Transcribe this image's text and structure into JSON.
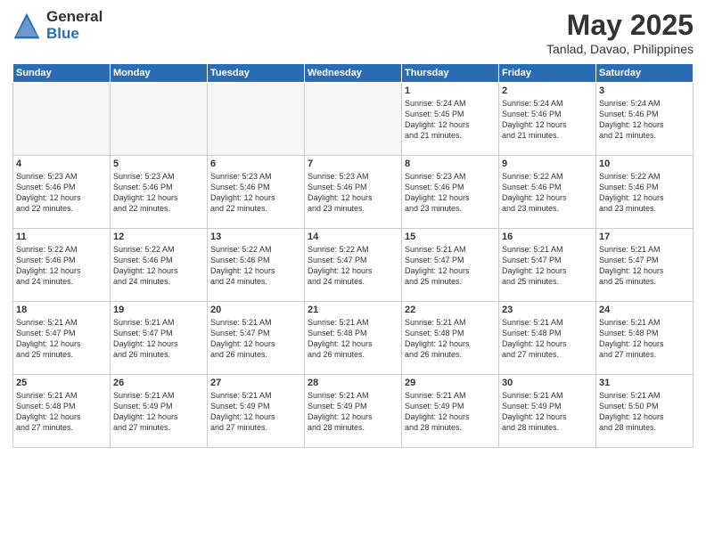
{
  "logo": {
    "general": "General",
    "blue": "Blue"
  },
  "title": {
    "month": "May 2025",
    "location": "Tanlad, Davao, Philippines"
  },
  "weekdays": [
    "Sunday",
    "Monday",
    "Tuesday",
    "Wednesday",
    "Thursday",
    "Friday",
    "Saturday"
  ],
  "weeks": [
    [
      {
        "day": "",
        "info": ""
      },
      {
        "day": "",
        "info": ""
      },
      {
        "day": "",
        "info": ""
      },
      {
        "day": "",
        "info": ""
      },
      {
        "day": "1",
        "info": "Sunrise: 5:24 AM\nSunset: 5:45 PM\nDaylight: 12 hours\nand 21 minutes."
      },
      {
        "day": "2",
        "info": "Sunrise: 5:24 AM\nSunset: 5:46 PM\nDaylight: 12 hours\nand 21 minutes."
      },
      {
        "day": "3",
        "info": "Sunrise: 5:24 AM\nSunset: 5:46 PM\nDaylight: 12 hours\nand 21 minutes."
      }
    ],
    [
      {
        "day": "4",
        "info": "Sunrise: 5:23 AM\nSunset: 5:46 PM\nDaylight: 12 hours\nand 22 minutes."
      },
      {
        "day": "5",
        "info": "Sunrise: 5:23 AM\nSunset: 5:46 PM\nDaylight: 12 hours\nand 22 minutes."
      },
      {
        "day": "6",
        "info": "Sunrise: 5:23 AM\nSunset: 5:46 PM\nDaylight: 12 hours\nand 22 minutes."
      },
      {
        "day": "7",
        "info": "Sunrise: 5:23 AM\nSunset: 5:46 PM\nDaylight: 12 hours\nand 23 minutes."
      },
      {
        "day": "8",
        "info": "Sunrise: 5:23 AM\nSunset: 5:46 PM\nDaylight: 12 hours\nand 23 minutes."
      },
      {
        "day": "9",
        "info": "Sunrise: 5:22 AM\nSunset: 5:46 PM\nDaylight: 12 hours\nand 23 minutes."
      },
      {
        "day": "10",
        "info": "Sunrise: 5:22 AM\nSunset: 5:46 PM\nDaylight: 12 hours\nand 23 minutes."
      }
    ],
    [
      {
        "day": "11",
        "info": "Sunrise: 5:22 AM\nSunset: 5:46 PM\nDaylight: 12 hours\nand 24 minutes."
      },
      {
        "day": "12",
        "info": "Sunrise: 5:22 AM\nSunset: 5:46 PM\nDaylight: 12 hours\nand 24 minutes."
      },
      {
        "day": "13",
        "info": "Sunrise: 5:22 AM\nSunset: 5:46 PM\nDaylight: 12 hours\nand 24 minutes."
      },
      {
        "day": "14",
        "info": "Sunrise: 5:22 AM\nSunset: 5:47 PM\nDaylight: 12 hours\nand 24 minutes."
      },
      {
        "day": "15",
        "info": "Sunrise: 5:21 AM\nSunset: 5:47 PM\nDaylight: 12 hours\nand 25 minutes."
      },
      {
        "day": "16",
        "info": "Sunrise: 5:21 AM\nSunset: 5:47 PM\nDaylight: 12 hours\nand 25 minutes."
      },
      {
        "day": "17",
        "info": "Sunrise: 5:21 AM\nSunset: 5:47 PM\nDaylight: 12 hours\nand 25 minutes."
      }
    ],
    [
      {
        "day": "18",
        "info": "Sunrise: 5:21 AM\nSunset: 5:47 PM\nDaylight: 12 hours\nand 25 minutes."
      },
      {
        "day": "19",
        "info": "Sunrise: 5:21 AM\nSunset: 5:47 PM\nDaylight: 12 hours\nand 26 minutes."
      },
      {
        "day": "20",
        "info": "Sunrise: 5:21 AM\nSunset: 5:47 PM\nDaylight: 12 hours\nand 26 minutes."
      },
      {
        "day": "21",
        "info": "Sunrise: 5:21 AM\nSunset: 5:48 PM\nDaylight: 12 hours\nand 26 minutes."
      },
      {
        "day": "22",
        "info": "Sunrise: 5:21 AM\nSunset: 5:48 PM\nDaylight: 12 hours\nand 26 minutes."
      },
      {
        "day": "23",
        "info": "Sunrise: 5:21 AM\nSunset: 5:48 PM\nDaylight: 12 hours\nand 27 minutes."
      },
      {
        "day": "24",
        "info": "Sunrise: 5:21 AM\nSunset: 5:48 PM\nDaylight: 12 hours\nand 27 minutes."
      }
    ],
    [
      {
        "day": "25",
        "info": "Sunrise: 5:21 AM\nSunset: 5:48 PM\nDaylight: 12 hours\nand 27 minutes."
      },
      {
        "day": "26",
        "info": "Sunrise: 5:21 AM\nSunset: 5:49 PM\nDaylight: 12 hours\nand 27 minutes."
      },
      {
        "day": "27",
        "info": "Sunrise: 5:21 AM\nSunset: 5:49 PM\nDaylight: 12 hours\nand 27 minutes."
      },
      {
        "day": "28",
        "info": "Sunrise: 5:21 AM\nSunset: 5:49 PM\nDaylight: 12 hours\nand 28 minutes."
      },
      {
        "day": "29",
        "info": "Sunrise: 5:21 AM\nSunset: 5:49 PM\nDaylight: 12 hours\nand 28 minutes."
      },
      {
        "day": "30",
        "info": "Sunrise: 5:21 AM\nSunset: 5:49 PM\nDaylight: 12 hours\nand 28 minutes."
      },
      {
        "day": "31",
        "info": "Sunrise: 5:21 AM\nSunset: 5:50 PM\nDaylight: 12 hours\nand 28 minutes."
      }
    ]
  ]
}
